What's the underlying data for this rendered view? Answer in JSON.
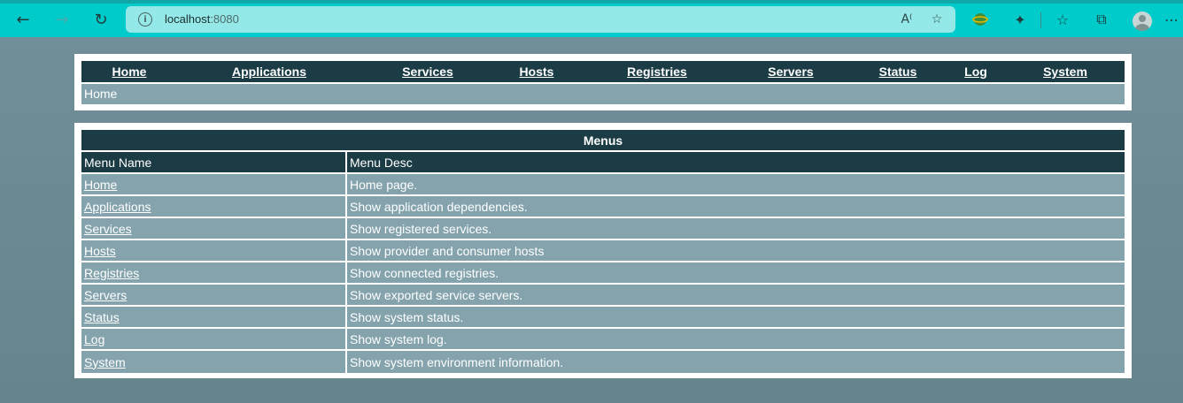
{
  "browser": {
    "url_host": "localhost",
    "url_port": ":8080",
    "icons": [
      "back-icon",
      "forward-icon",
      "refresh-icon",
      "info-icon",
      "read-aloud-icon",
      "add-favorite-icon",
      "extension-globe-icon",
      "extensions-icon",
      "favorites-icon",
      "collections-icon",
      "profile-icon",
      "more-icon"
    ]
  },
  "nav": {
    "items": [
      {
        "label": "Home"
      },
      {
        "label": "Applications"
      },
      {
        "label": "Services"
      },
      {
        "label": "Hosts"
      },
      {
        "label": "Registries"
      },
      {
        "label": "Servers"
      },
      {
        "label": "Status"
      },
      {
        "label": "Log"
      },
      {
        "label": "System"
      }
    ]
  },
  "breadcrumb": "Home",
  "menus": {
    "title": "Menus",
    "col_name": "Menu Name",
    "col_desc": "Menu Desc",
    "rows": [
      {
        "name": "Home",
        "desc": "Home page."
      },
      {
        "name": "Applications",
        "desc": "Show application dependencies."
      },
      {
        "name": "Services",
        "desc": "Show registered services."
      },
      {
        "name": "Hosts",
        "desc": "Show provider and consumer hosts"
      },
      {
        "name": "Registries",
        "desc": "Show connected registries."
      },
      {
        "name": "Servers",
        "desc": "Show exported service servers."
      },
      {
        "name": "Status",
        "desc": "Show system status."
      },
      {
        "name": "Log",
        "desc": "Show system log."
      },
      {
        "name": "System",
        "desc": "Show system environment information."
      }
    ]
  },
  "colors": {
    "chrome": "#00cbcb",
    "address_bar": "#94e8e8",
    "header_dark": "#1b3c45",
    "row_blue": "#84a3ad",
    "page_bg": "#6e8c95"
  }
}
